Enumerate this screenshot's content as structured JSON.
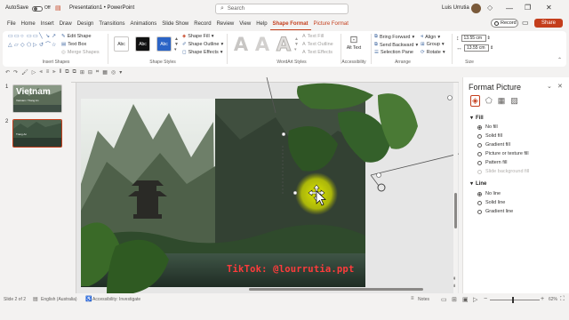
{
  "titlebar": {
    "autosave_label": "AutoSave",
    "autosave_state": "Off",
    "doc_title": "Presentation1 • PowerPoint",
    "search_placeholder": "Search",
    "user_name": "Luis Urrutia",
    "minimize": "—",
    "restore": "❐",
    "close": "✕"
  },
  "tabs": [
    {
      "label": "File"
    },
    {
      "label": "Home"
    },
    {
      "label": "Insert"
    },
    {
      "label": "Draw"
    },
    {
      "label": "Design"
    },
    {
      "label": "Transitions"
    },
    {
      "label": "Animations"
    },
    {
      "label": "Slide Show"
    },
    {
      "label": "Record"
    },
    {
      "label": "Review"
    },
    {
      "label": "View"
    },
    {
      "label": "Help"
    },
    {
      "label": "Shape Format"
    },
    {
      "label": "Picture Format"
    }
  ],
  "ribbon_right": {
    "record_label": "Record",
    "share_label": "Share"
  },
  "ribbon": {
    "insert_shapes": {
      "edit_shape": "Edit Shape",
      "text_box": "Text Box",
      "merge_shapes": "Merge Shapes",
      "label": "Insert Shapes"
    },
    "shape_styles": {
      "swatch1": "Abc",
      "swatch2": "Abc",
      "swatch3": "Abc",
      "fill": "Shape Fill",
      "outline": "Shape Outline",
      "effects": "Shape Effects",
      "label": "Shape Styles"
    },
    "wordart": {
      "text_fill": "Text Fill",
      "text_outline": "Text Outline",
      "text_effects": "Text Effects",
      "label": "WordArt Styles"
    },
    "accessibility": {
      "alt_text": "Alt Text",
      "label": "Accessibility"
    },
    "arrange": {
      "bring_forward": "Bring Forward",
      "send_backward": "Send Backward",
      "selection_pane": "Selection Pane",
      "align": "Align",
      "group": "Group",
      "rotate": "Rotate",
      "label": "Arrange"
    },
    "size": {
      "height": "13.55 cm",
      "width": "13.55 cm",
      "label": "Size"
    }
  },
  "slides": [
    {
      "num": "1",
      "title": "Vietnam",
      "subtitle": "Vietnam / Trang An"
    },
    {
      "num": "2",
      "subtitle": "Trang An"
    }
  ],
  "slide": {
    "watermark": "TikTok: @lourrutia.ppt"
  },
  "pane": {
    "title": "Format Picture",
    "fill_section": "Fill",
    "fill_options": [
      {
        "label": "No fill",
        "checked": true,
        "enabled": true
      },
      {
        "label": "Solid fill",
        "checked": false,
        "enabled": true
      },
      {
        "label": "Gradient fill",
        "checked": false,
        "enabled": true
      },
      {
        "label": "Picture or texture fill",
        "checked": false,
        "enabled": true
      },
      {
        "label": "Pattern fill",
        "checked": false,
        "enabled": true
      },
      {
        "label": "Slide background fill",
        "checked": false,
        "enabled": false
      }
    ],
    "line_section": "Line",
    "line_options": [
      {
        "label": "No line",
        "checked": true
      },
      {
        "label": "Solid line",
        "checked": false
      },
      {
        "label": "Gradient line",
        "checked": false
      }
    ]
  },
  "status": {
    "slide_info": "Slide 2 of 2",
    "language": "English (Australia)",
    "accessibility": "Accessibility: Investigate",
    "notes": "Notes",
    "zoom": "62%"
  },
  "colors": {
    "accent": "#c43e1c",
    "selection_glow": "#d8e000",
    "watermark": "#ff3b3b"
  }
}
